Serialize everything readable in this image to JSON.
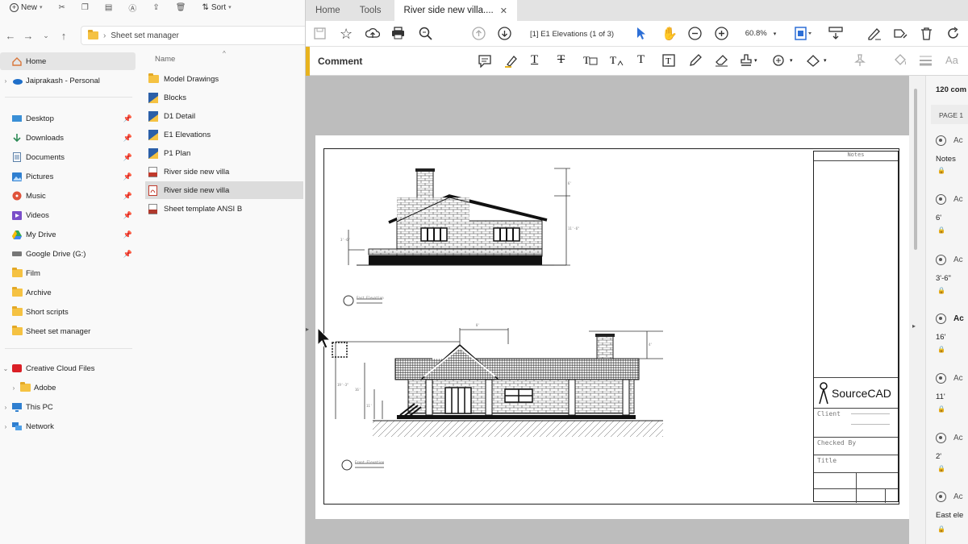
{
  "explorer": {
    "toolbar": {
      "new_label": "New",
      "sort_label": "Sort"
    },
    "address": {
      "path": "Sheet set manager"
    },
    "nav_items": [
      {
        "label": "Home",
        "icon": "home-icon"
      },
      {
        "label": "Jaiprakash - Personal",
        "icon": "onedrive-icon"
      },
      {
        "label": "Desktop",
        "icon": "desktop-icon"
      },
      {
        "label": "Downloads",
        "icon": "download-icon"
      },
      {
        "label": "Documents",
        "icon": "document-icon"
      },
      {
        "label": "Pictures",
        "icon": "picture-icon"
      },
      {
        "label": "Music",
        "icon": "music-icon"
      },
      {
        "label": "Videos",
        "icon": "video-icon"
      },
      {
        "label": "My Drive",
        "icon": "drive-icon"
      },
      {
        "label": "Google Drive (G:)",
        "icon": "disk-icon"
      },
      {
        "label": "Film",
        "icon": "folder-icon"
      },
      {
        "label": "Archive",
        "icon": "folder-icon"
      },
      {
        "label": "Short scripts",
        "icon": "folder-icon"
      },
      {
        "label": "Sheet set manager",
        "icon": "folder-icon"
      },
      {
        "label": "Creative Cloud Files",
        "icon": "creative-cloud-icon"
      },
      {
        "label": "Adobe",
        "icon": "folder-icon"
      },
      {
        "label": "This PC",
        "icon": "pc-icon"
      },
      {
        "label": "Network",
        "icon": "network-icon"
      }
    ],
    "column_header": "Name",
    "files": [
      {
        "name": "Model Drawings",
        "icon": "folder-icon"
      },
      {
        "name": "Blocks",
        "icon": "dwg-icon"
      },
      {
        "name": "D1 Detail",
        "icon": "dwg-icon"
      },
      {
        "name": "E1 Elevations",
        "icon": "dwg-icon"
      },
      {
        "name": "P1 Plan",
        "icon": "dwg-icon"
      },
      {
        "name": "River side new villa",
        "icon": "dst-icon"
      },
      {
        "name": "River side new villa",
        "icon": "pdf-icon"
      },
      {
        "name": "Sheet template ANSI B",
        "icon": "dwt-icon"
      }
    ]
  },
  "acrobat": {
    "tabs": {
      "home": "Home",
      "tools": "Tools",
      "doc": "River side new villa...."
    },
    "page_label": "[1] E1 Elevations",
    "page_count": "(1 of 3)",
    "zoom": "60.8%",
    "comment_label": "Comment",
    "drawing": {
      "notes_header": "Notes",
      "brand": "SourceCAD",
      "client_label": "Client",
      "checked_label": "Checked By",
      "title_label": "Title",
      "east_label": "East Elevation",
      "front_label": "Front Elevation",
      "dim_6": "6'",
      "dim_11_6": "11'-6\"",
      "dim_8": "8'",
      "dim_4": "4'",
      "dim_19": "19'-3\"",
      "dim_16": "16'",
      "dim_11": "11'",
      "dim_3_6": "3'-6\""
    },
    "comments_panel": {
      "count": "120 com",
      "page_header": "PAGE 1",
      "items": [
        {
          "author": "Ac",
          "text": "Notes"
        },
        {
          "author": "Ac",
          "text": "6'"
        },
        {
          "author": "Ac",
          "text": "3'-6\""
        },
        {
          "author": "Ac",
          "text": "16'"
        },
        {
          "author": "Ac",
          "text": "11'"
        },
        {
          "author": "Ac",
          "text": "2'"
        },
        {
          "author": "Ac",
          "text": "East ele"
        }
      ]
    }
  }
}
